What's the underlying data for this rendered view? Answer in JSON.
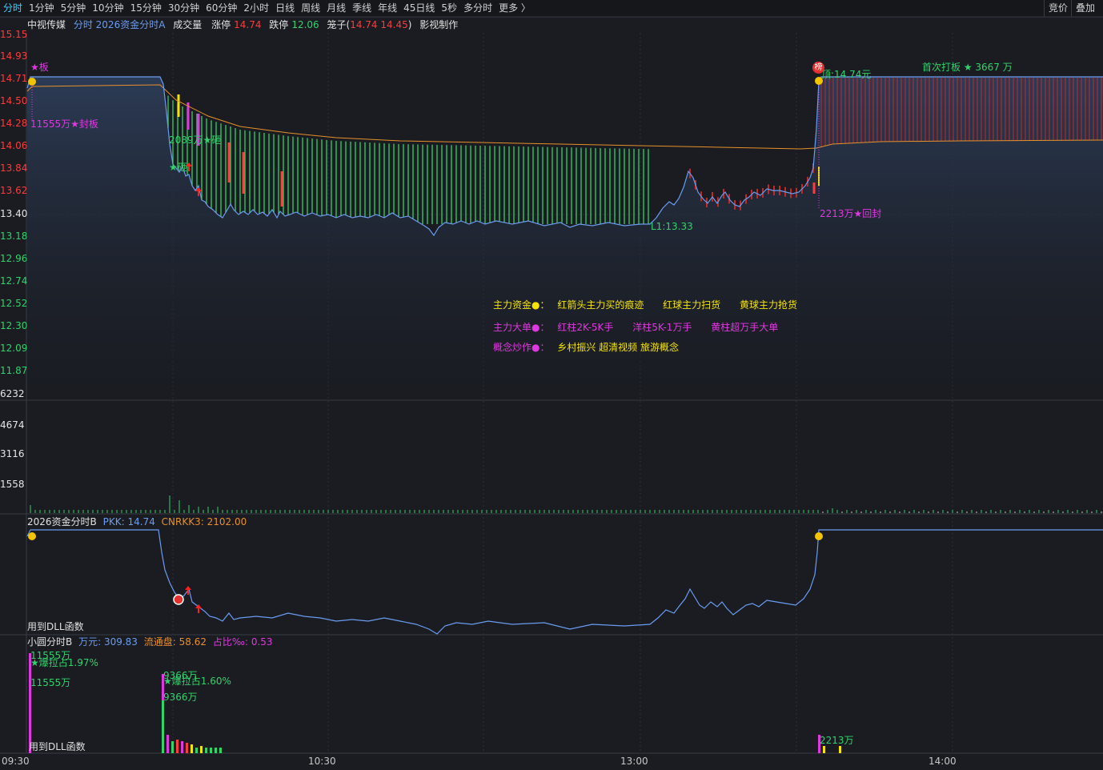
{
  "toolbar": {
    "timeframes": [
      "分时",
      "1分钟",
      "5分钟",
      "10分钟",
      "15分钟",
      "30分钟",
      "60分钟",
      "2小时",
      "日线",
      "周线",
      "月线",
      "季线",
      "年线",
      "45日线",
      "5秒",
      "多分时",
      "更多 〉"
    ],
    "right_buttons": [
      "竞价",
      "叠加"
    ]
  },
  "header": {
    "stock_name": "中视传媒",
    "indicator": "分时 2026资金分时A",
    "volume_label": "成交量",
    "limit_up_label": "涨停",
    "limit_up_value": "14.74",
    "limit_down_label": "跌停",
    "limit_down_value": "12.06",
    "cage_label": "笼子(",
    "cage_values": "14.74 14.45",
    "cage_close": ")",
    "sector": "影视制作"
  },
  "price_axis": [
    "15.15",
    "14.93",
    "14.71",
    "14.50",
    "14.28",
    "14.06",
    "13.84",
    "13.62",
    "13.40",
    "13.18",
    "12.96",
    "12.74",
    "12.52",
    "12.30",
    "12.09",
    "11.87"
  ],
  "volume_axis": [
    "6232",
    "4674",
    "3116",
    "1558"
  ],
  "annotations": {
    "board_star": "★板",
    "seal_amount": "11555万★封板",
    "mid_amount": "2089万★砸",
    "smash": "★砸",
    "low_label": "L1:13.33",
    "top_label": "顶:14.74元",
    "reseal": "2213万★回封",
    "first_board": "首次打板 ★ 3667 万",
    "rank_badge": "榜"
  },
  "legend": {
    "row1_title": "主力资金●：",
    "row1_items": [
      "红箭头主力买的痕迹",
      "红球主力扫货",
      "黄球主力抢货"
    ],
    "row2_title": "主力大单●：",
    "row2_items": [
      "红柱2K-5K手",
      "洋柱5K-1万手",
      "黄柱超万手大单"
    ],
    "row3_title": "概念炒作●：",
    "row3_items": "乡村振兴 超清视频 旅游概念"
  },
  "panel_b": {
    "title": "2026资金分时B",
    "pkk_label": "PKK:",
    "pkk_value": "14.74",
    "cnrkk_label": "CNRKK3:",
    "cnrkk_value": "2102.00",
    "dll": "用到DLL函数"
  },
  "panel_c": {
    "title": "小圆分时B",
    "wan_label": "万元:",
    "wan_value": "309.83",
    "float_label": "流通盘:",
    "float_value": "58.62",
    "ratio_label": "占比‰:",
    "ratio_value": "0.53",
    "dll": "用到DLL函数",
    "a1": "11555万",
    "a2": "★爆拉占1.97%",
    "a3": "11555万",
    "b1": "9366万",
    "b2": "★爆拉占1.60%",
    "b3": "9366万",
    "c1": "2213万"
  },
  "time_axis": [
    "09:30",
    "10:30",
    "13:00",
    "14:00"
  ],
  "colors": {
    "price_line": "#6a9cf0",
    "avg_line": "#e8902a",
    "up": "#ff3b3b",
    "down": "#2fd46b",
    "magenta": "#e038e0",
    "yellow": "#f5e400",
    "grid": "#2c2f38"
  }
}
